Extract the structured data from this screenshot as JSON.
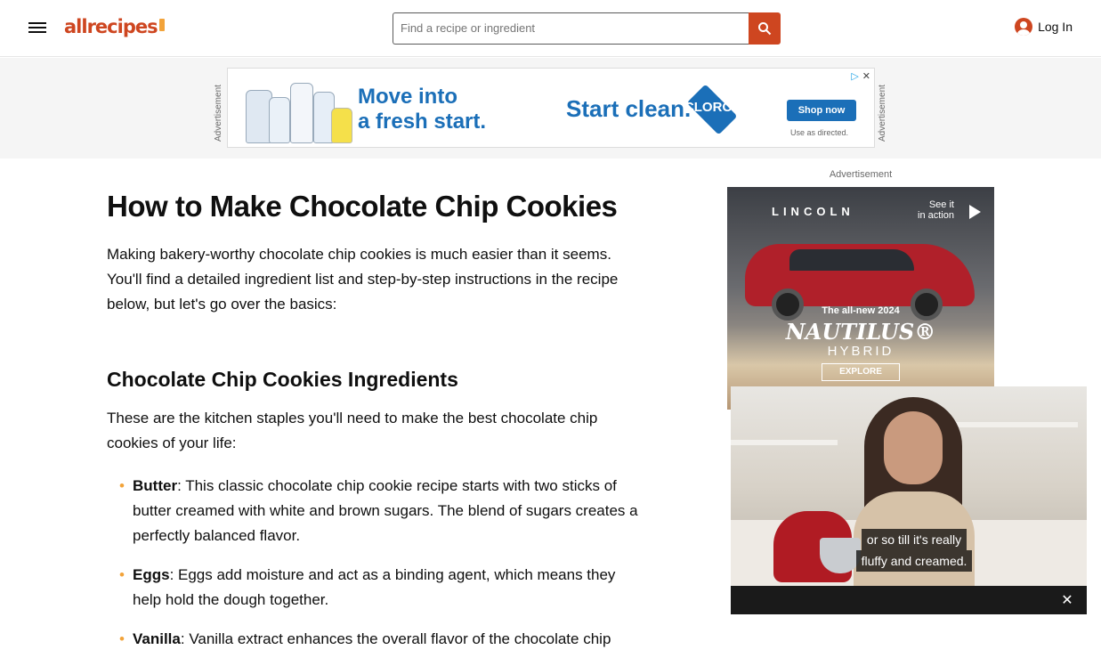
{
  "header": {
    "logo_text": "allrecipes",
    "search_placeholder": "Find a recipe or ingredient",
    "login_label": "Log In"
  },
  "banner_ad": {
    "label_left": "Advertisement",
    "label_right": "Advertisement",
    "headline_line1": "Move into",
    "headline_line2": "a fresh start.",
    "cta_text": "Start clean.",
    "brand": "CLOROX",
    "button": "Shop now",
    "disclaimer": "Use as directed."
  },
  "article": {
    "title": "How to Make Chocolate Chip Cookies",
    "intro": "Making bakery-worthy chocolate chip cookies is much easier than it seems. You'll find a detailed ingredient list and step-by-step instructions in the recipe below, but let's go over the basics:",
    "section_title": "Chocolate Chip Cookies Ingredients",
    "section_intro": "These are the kitchen staples you'll need to make the best chocolate chip cookies of your life:",
    "ingredients": [
      {
        "name": "Butter",
        "text": ": This classic chocolate chip cookie recipe starts with two sticks of butter creamed with white and brown sugars. The blend of sugars creates a perfectly balanced flavor."
      },
      {
        "name": "Eggs",
        "text": ": Eggs add moisture and act as a binding agent, which means they help hold the dough together."
      },
      {
        "name": "Vanilla",
        "text": ": Vanilla extract enhances the overall flavor of the chocolate chip"
      }
    ]
  },
  "side_ad": {
    "label": "Advertisement",
    "brand": "LINCOLN",
    "see_it_line1": "See it",
    "see_it_line2": "in action",
    "tagline": "The all-new 2024",
    "model": "NAUTILUS®",
    "subtitle": "HYBRID",
    "button": "EXPLORE"
  },
  "video": {
    "caption_line1": "or so till it's really",
    "caption_line2": "fluffy and creamed.",
    "close_symbol": "✕"
  }
}
